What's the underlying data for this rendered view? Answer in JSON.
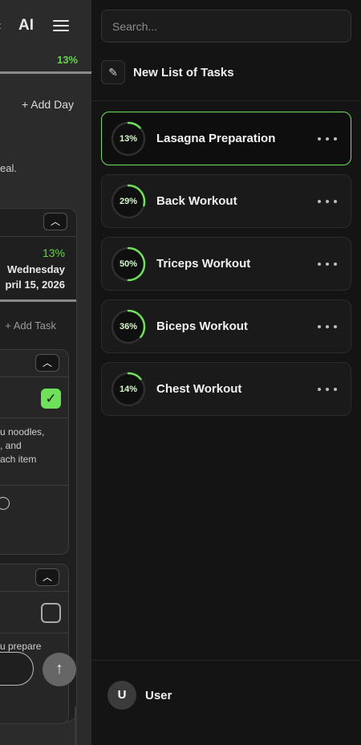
{
  "background": {
    "ai_label": "AI",
    "progress_top": "13%",
    "add_day": "+ Add Day",
    "meal_fragment": "eal.",
    "card": {
      "progress": "13%",
      "weekday": "Wednesday",
      "date": "pril 15, 2026",
      "add_task": "+ Add Task"
    },
    "task1": {
      "checked": true,
      "desc_lines": [
        "u noodles,",
        ", and",
        "ach item"
      ]
    },
    "task2": {
      "checked": false,
      "desc_lines": [
        "u prepare",
        "k"
      ]
    }
  },
  "drawer": {
    "search_placeholder": "Search...",
    "new_list_label": "New List of Tasks",
    "accent_color": "#6ee05a",
    "lists": [
      {
        "title": "Lasagna Preparation",
        "progress_label": "13%",
        "progress": 0.13,
        "active": true
      },
      {
        "title": "Back Workout",
        "progress_label": "29%",
        "progress": 0.29,
        "active": false
      },
      {
        "title": "Triceps Workout",
        "progress_label": "50%",
        "progress": 0.5,
        "active": false
      },
      {
        "title": "Biceps Workout",
        "progress_label": "36%",
        "progress": 0.36,
        "active": false
      },
      {
        "title": "Chest Workout",
        "progress_label": "14%",
        "progress": 0.14,
        "active": false
      }
    ],
    "user": {
      "initial": "U",
      "name": "User"
    }
  }
}
